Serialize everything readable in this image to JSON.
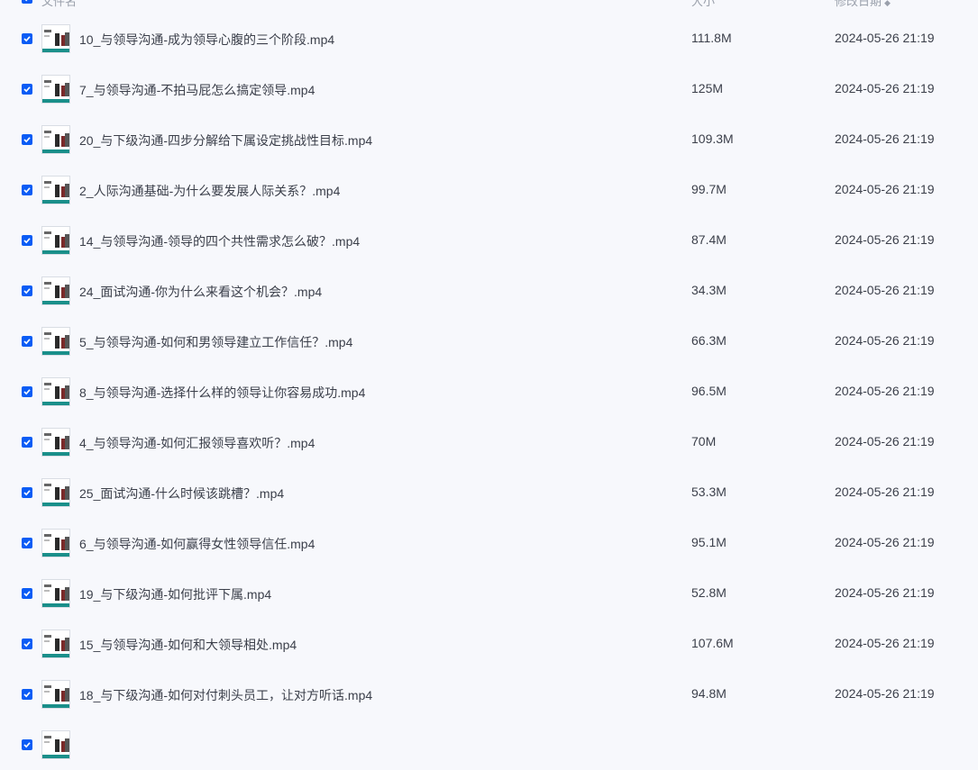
{
  "header": {
    "name_label": "文件名",
    "size_label": "大小",
    "date_label": "修改日期",
    "sort_icon": "sort-down-icon"
  },
  "files": [
    {
      "name": "10_与领导沟通-成为领导心腹的三个阶段.mp4",
      "size": "111.8M",
      "date": "2024-05-26 21:19",
      "checked": true
    },
    {
      "name": "7_与领导沟通-不拍马屁怎么搞定领导.mp4",
      "size": "125M",
      "date": "2024-05-26 21:19",
      "checked": true
    },
    {
      "name": "20_与下级沟通-四步分解给下属设定挑战性目标.mp4",
      "size": "109.3M",
      "date": "2024-05-26 21:19",
      "checked": true
    },
    {
      "name": "2_人际沟通基础-为什么要发展人际关系？.mp4",
      "size": "99.7M",
      "date": "2024-05-26 21:19",
      "checked": true
    },
    {
      "name": "14_与领导沟通-领导的四个共性需求怎么破？.mp4",
      "size": "87.4M",
      "date": "2024-05-26 21:19",
      "checked": true
    },
    {
      "name": "24_面试沟通-你为什么来看这个机会？.mp4",
      "size": "34.3M",
      "date": "2024-05-26 21:19",
      "checked": true
    },
    {
      "name": "5_与领导沟通-如何和男领导建立工作信任？.mp4",
      "size": "66.3M",
      "date": "2024-05-26 21:19",
      "checked": true
    },
    {
      "name": "8_与领导沟通-选择什么样的领导让你容易成功.mp4",
      "size": "96.5M",
      "date": "2024-05-26 21:19",
      "checked": true
    },
    {
      "name": "4_与领导沟通-如何汇报领导喜欢听？.mp4",
      "size": "70M",
      "date": "2024-05-26 21:19",
      "checked": true
    },
    {
      "name": "25_面试沟通-什么时候该跳槽？.mp4",
      "size": "53.3M",
      "date": "2024-05-26 21:19",
      "checked": true
    },
    {
      "name": "6_与领导沟通-如何赢得女性领导信任.mp4",
      "size": "95.1M",
      "date": "2024-05-26 21:19",
      "checked": true
    },
    {
      "name": "19_与下级沟通-如何批评下属.mp4",
      "size": "52.8M",
      "date": "2024-05-26 21:19",
      "checked": true
    },
    {
      "name": "15_与领导沟通-如何和大领导相处.mp4",
      "size": "107.6M",
      "date": "2024-05-26 21:19",
      "checked": true
    },
    {
      "name": "18_与下级沟通-如何对付刺头员工，让对方听话.mp4",
      "size": "94.8M",
      "date": "2024-05-26 21:19",
      "checked": true
    },
    {
      "name": "",
      "size": "",
      "date": "",
      "checked": true
    }
  ],
  "colors": {
    "accent": "#0a5cf5",
    "background": "#f7f8fc",
    "text": "#3b3f4a",
    "header_text": "#9aa0ab"
  }
}
